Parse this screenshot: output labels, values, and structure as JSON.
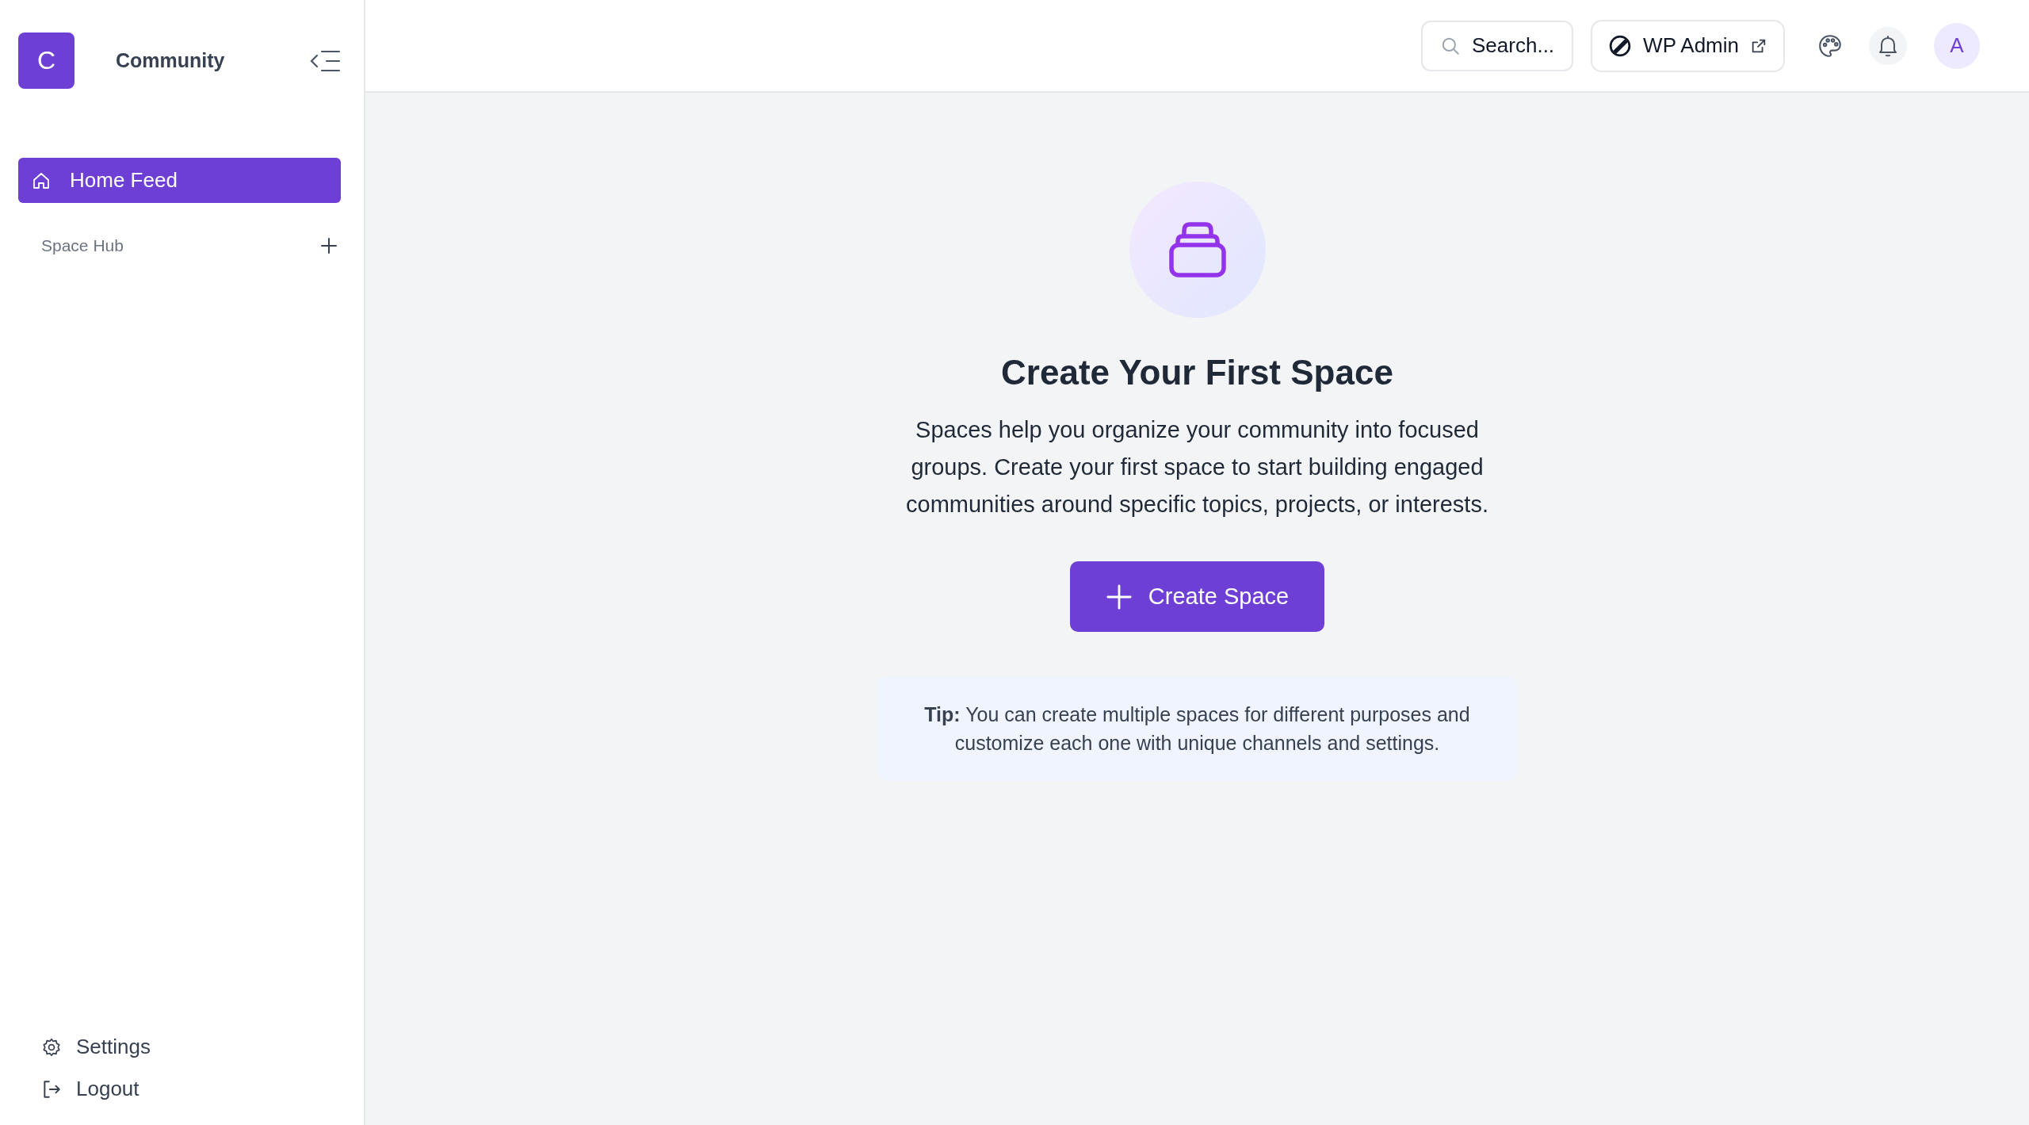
{
  "brand": {
    "initial": "C",
    "name": "Community"
  },
  "nav": [
    {
      "label": "Home Feed",
      "kind": "home",
      "selected": true
    }
  ],
  "space_hub": {
    "label": "Space Hub"
  },
  "footer_links": [
    {
      "label": "Settings",
      "kind": "settings"
    },
    {
      "label": "Logout",
      "kind": "logout"
    }
  ],
  "topbar": {
    "search": {
      "label": "Search..."
    },
    "wp_admin": {
      "label": "WP Admin"
    },
    "avatar": "A"
  },
  "empty_state": {
    "title": "Create Your First Space",
    "description": "Spaces help you organize your community into focused groups. Create your first space to start building engaged communities around specific topics, projects, or interests.",
    "button": "Create Space",
    "tip": "**Tip:** You can create multiple spaces for different purposes and customize each one with unique channels and settings."
  }
}
